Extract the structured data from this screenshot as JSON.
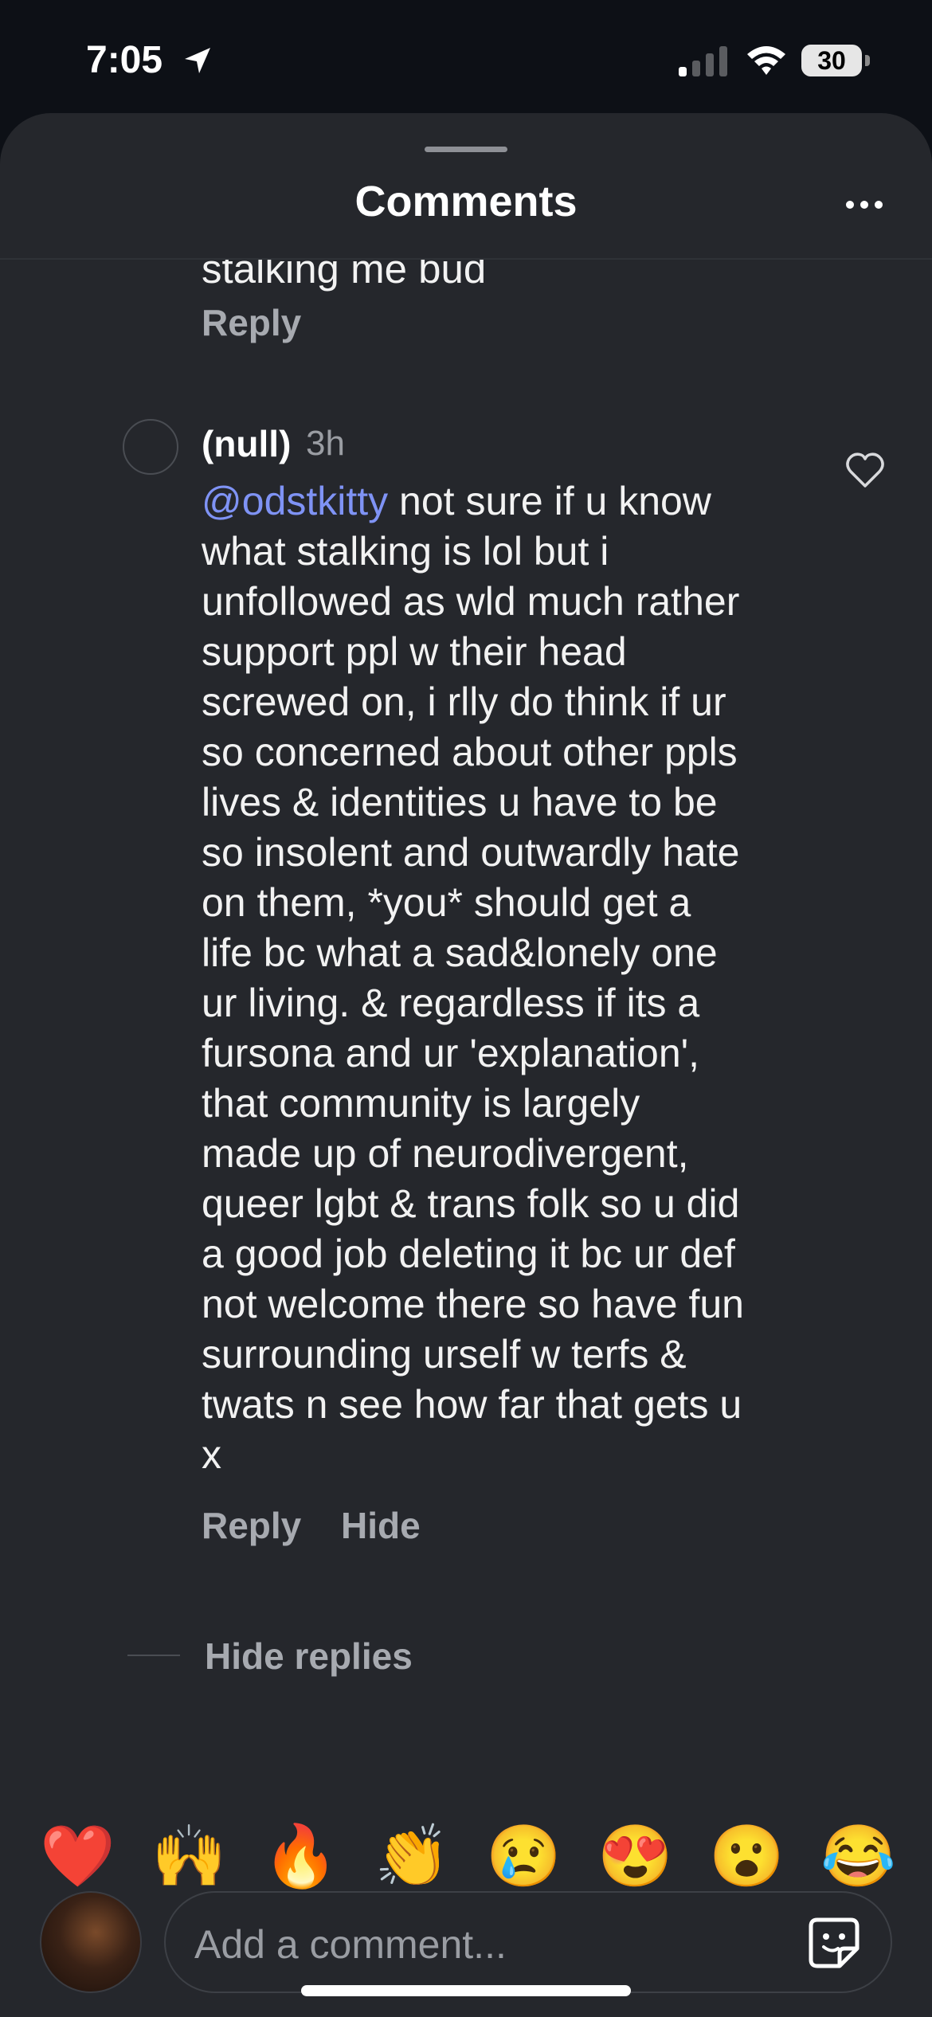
{
  "status_bar": {
    "time": "7:05",
    "battery": "30"
  },
  "sheet": {
    "title": "Comments"
  },
  "previous_comment": {
    "tail_text": "stalking me bud",
    "reply_label": "Reply"
  },
  "comment": {
    "username": "(null)",
    "timestamp": "3h",
    "mention": "@odstkitty",
    "lines": [
      " not sure if u know",
      "what stalking is lol but i",
      "unfollowed as wld much rather",
      "support ppl w their head",
      "screwed on, i rlly do think if ur",
      "so concerned about other ppls",
      "lives & identities u have to be",
      "so insolent and outwardly hate",
      "on them, *you* should get a",
      "life bc what a sad&lonely one",
      "ur living. & regardless if its a",
      "fursona and ur 'explanation',",
      "that community is largely",
      "made up of neurodivergent,",
      "queer lgbt & trans folk so u did",
      "a good job deleting it bc ur def",
      "not welcome there so have fun",
      "surrounding urself w terfs &",
      "twats n see how far that gets u",
      "x"
    ],
    "reply_label": "Reply",
    "hide_label": "Hide"
  },
  "hide_replies_label": "Hide replies",
  "reactions": [
    "❤️",
    "🙌",
    "🔥",
    "👏",
    "😢",
    "😍",
    "😮",
    "😂"
  ],
  "composer": {
    "placeholder": "Add a comment..."
  },
  "colors": {
    "sheet_bg": "#25272c",
    "mention": "#7f93f5",
    "secondary_text": "#a7aab0"
  }
}
